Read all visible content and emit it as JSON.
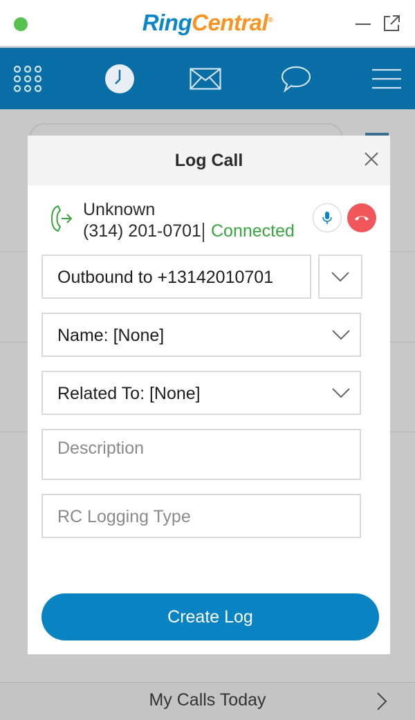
{
  "brand": {
    "ring": "Ring",
    "central": "Central",
    "reg": "®"
  },
  "colors": {
    "nav": "#0a6ea6",
    "accent": "#0a83c3",
    "status_dot": "#59c14f",
    "connected": "#3aa53f",
    "hangup": "#f0575a"
  },
  "nav": {
    "items": [
      "dialpad-icon",
      "clock-icon",
      "envelope-icon",
      "chat-bubble-icon",
      "menu-icon"
    ]
  },
  "modal": {
    "title": "Log Call",
    "call": {
      "name": "Unknown",
      "number": "(314) 201-0701",
      "status": "Connected"
    },
    "fields": {
      "direction": "Outbound to +13142010701",
      "name": "Name: [None]",
      "related": "Related To: [None]",
      "description_placeholder": "Description",
      "logging_type_placeholder": "RC Logging Type"
    },
    "create_label": "Create Log"
  },
  "footer": {
    "label": "My Calls Today"
  }
}
